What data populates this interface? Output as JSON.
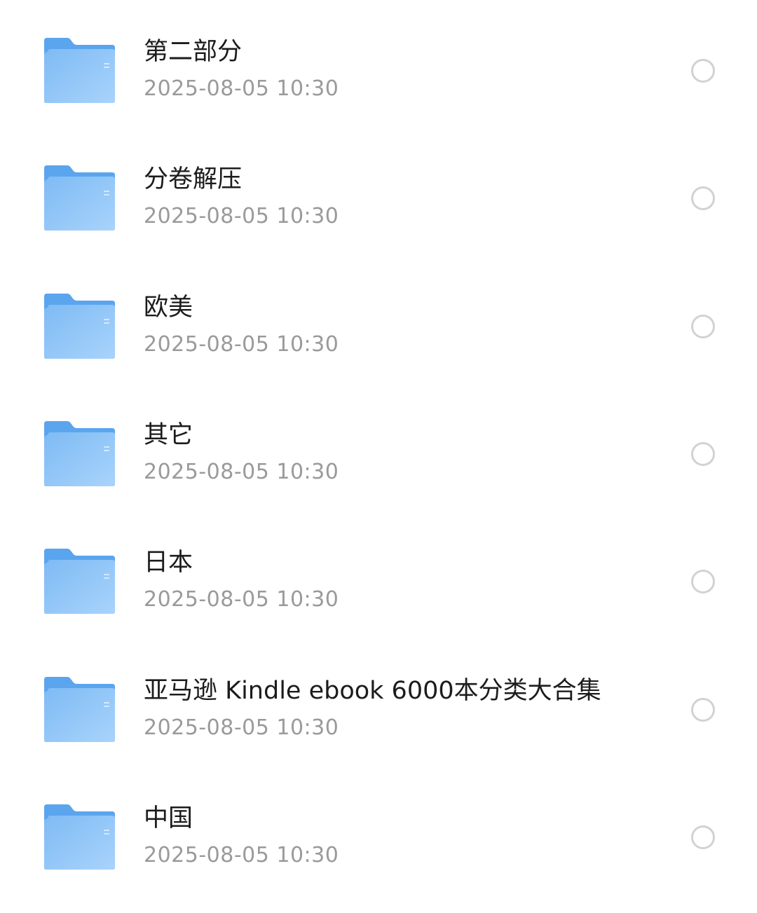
{
  "files": [
    {
      "name": "第二部分",
      "date": "2025-08-05 10:30"
    },
    {
      "name": "分卷解压",
      "date": "2025-08-05 10:30"
    },
    {
      "name": "欧美",
      "date": "2025-08-05 10:30"
    },
    {
      "name": "其它",
      "date": "2025-08-05 10:30"
    },
    {
      "name": "日本",
      "date": "2025-08-05 10:30"
    },
    {
      "name": "亚马逊 Kindle ebook 6000本分类大合集",
      "date": "2025-08-05 10:30"
    },
    {
      "name": "中国",
      "date": "2025-08-05 10:30"
    }
  ],
  "icons": {
    "folder": "folder-icon",
    "select": "radio-unchecked-icon"
  },
  "colors": {
    "folder_back": "#5aa5ee",
    "folder_front_top": "#7ebbf4",
    "folder_front_bottom": "#a9d3fb",
    "name_text": "#1c1c1c",
    "date_text": "#9a9a9a",
    "radio_border": "#d2d2d2"
  }
}
